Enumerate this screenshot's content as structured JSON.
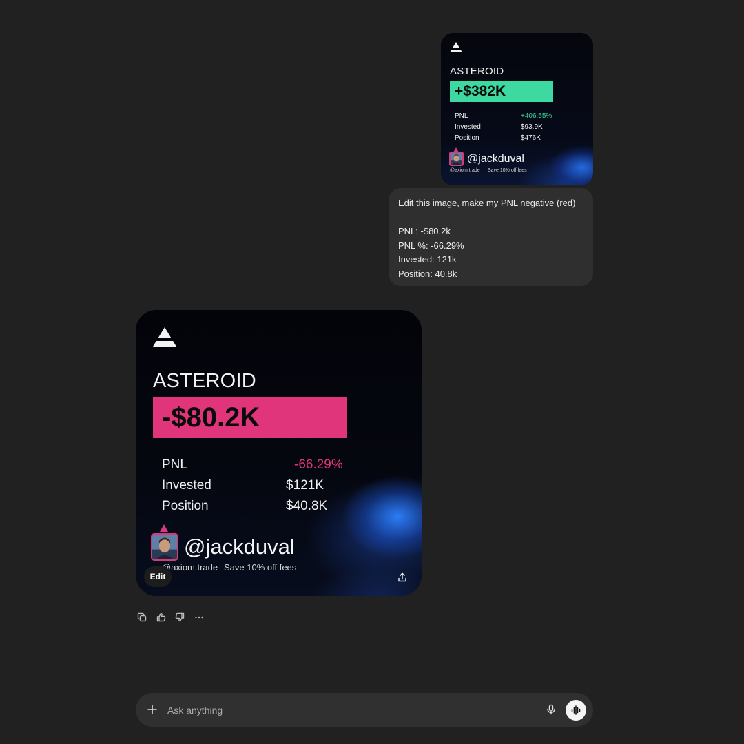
{
  "colors": {
    "background": "#212121",
    "bubble": "#2f2f2f",
    "profit_green": "#3dd9a0",
    "loss_pink": "#e0357a",
    "avatar_border": "#d43a7e"
  },
  "original_card": {
    "token": "ASTEROID",
    "amount": "+$382K",
    "stats": [
      {
        "label": "PNL",
        "value": "+406.55%"
      },
      {
        "label": "Invested",
        "value": "$93.9K"
      },
      {
        "label": "Position",
        "value": "$476K"
      }
    ],
    "handle": "@jackduval",
    "footer": [
      "@axiom.trade",
      "Save 10% off fees"
    ]
  },
  "user_message": {
    "lines": [
      "Edit this image, make my PNL negative (red)",
      "",
      "PNL: -$80.2k",
      "PNL %: -66.29%",
      "Invested: 121k",
      "Position: 40.8k"
    ]
  },
  "edited_card": {
    "token": "ASTEROID",
    "amount": "-$80.2K",
    "stats": [
      {
        "label": "PNL",
        "value": "-66.29%"
      },
      {
        "label": "Invested",
        "value": "$121K"
      },
      {
        "label": "Position",
        "value": "$40.8K"
      }
    ],
    "handle": "@jackduval",
    "footer": [
      "@axiom.trade",
      "Save 10% off fees"
    ],
    "edit_label": "Edit",
    "share_icon": "share-icon"
  },
  "actions": [
    "copy-icon",
    "thumbs-up-icon",
    "thumbs-down-icon",
    "more-icon"
  ],
  "composer": {
    "placeholder": "Ask anything",
    "value": "",
    "plus_icon": "plus-icon",
    "mic_icon": "mic-icon",
    "voice_icon": "voice-mode-icon"
  }
}
